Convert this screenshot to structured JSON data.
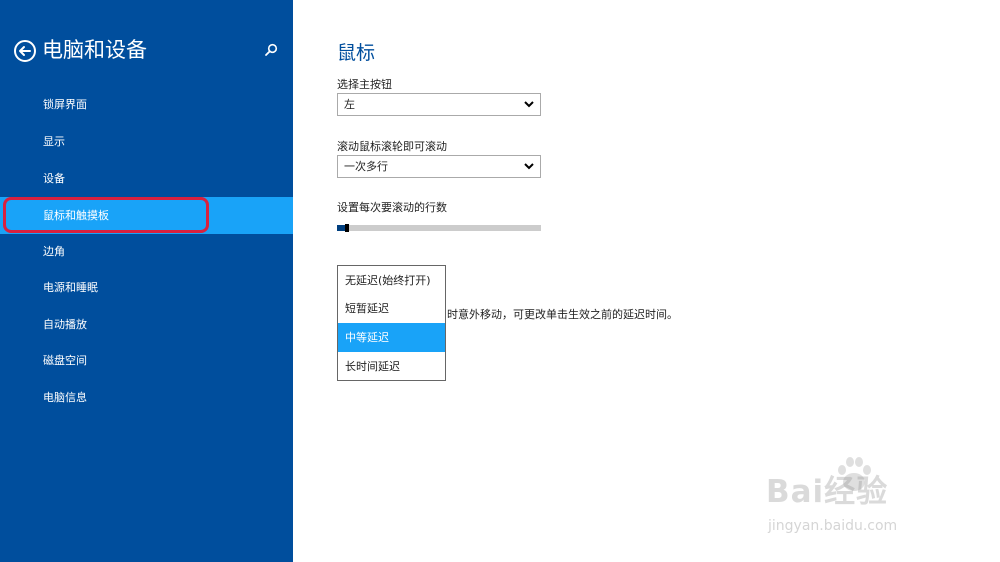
{
  "sidebar": {
    "title": "电脑和设备",
    "items": [
      {
        "label": "锁屏界面"
      },
      {
        "label": "显示"
      },
      {
        "label": "设备"
      },
      {
        "label": "鼠标和触摸板"
      },
      {
        "label": "边角"
      },
      {
        "label": "电源和睡眠"
      },
      {
        "label": "自动播放"
      },
      {
        "label": "磁盘空间"
      },
      {
        "label": "电脑信息"
      }
    ],
    "selected_index": 3,
    "back_icon": "back-arrow-circle-icon",
    "search_icon": "search-icon"
  },
  "main": {
    "title": "鼠标",
    "primary_button": {
      "label": "选择主按钮",
      "value": "左"
    },
    "scroll_mode": {
      "label": "滚动鼠标滚轮即可滚动",
      "value": "一次多行"
    },
    "scroll_lines": {
      "label": "设置每次要滚动的行数",
      "level": 0.02
    },
    "delay_text": "时意外移动，可更改单击生效之前的延迟时间。",
    "delay_options": [
      "无延迟(始终打开)",
      "短暂延迟",
      "中等延迟",
      "长时间延迟"
    ],
    "delay_selected_index": 2
  },
  "watermark": {
    "text": "Bai经验",
    "url": "jingyan.baidu.com"
  },
  "colors": {
    "sidebar": "#004e9d",
    "accent": "#19a3f8",
    "highlight": "#d8213f"
  }
}
